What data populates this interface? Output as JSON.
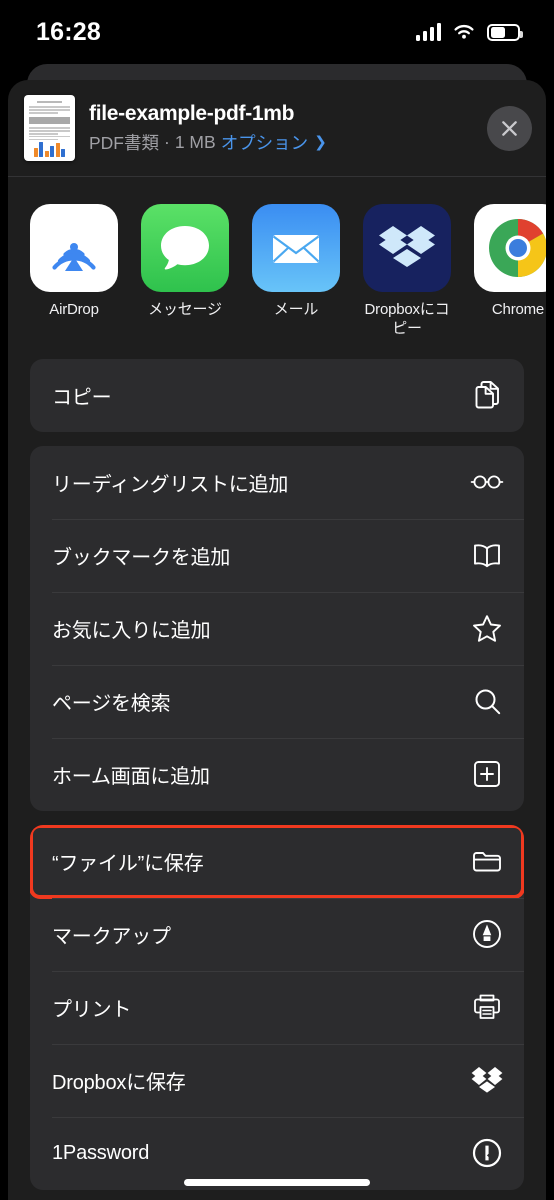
{
  "status_bar": {
    "time": "16:28",
    "cellular_icon": "cellular-bars-icon",
    "wifi_icon": "wifi-icon",
    "battery_icon": "battery-icon",
    "battery_level": 52
  },
  "share_sheet": {
    "file": {
      "name": "file-example-pdf-1mb",
      "kind": "PDF書類",
      "separator": "·",
      "size": "1 MB",
      "options_label": "オプション",
      "options_chevron": "chevron-right-icon",
      "thumbnail_icon": "pdf-thumbnail"
    },
    "close_label": "×",
    "apps": [
      {
        "label": "AirDrop",
        "icon": "airdrop-icon"
      },
      {
        "label": "メッセージ",
        "icon": "messages-icon"
      },
      {
        "label": "メール",
        "icon": "mail-icon"
      },
      {
        "label": "Dropboxにコピー",
        "icon": "dropbox-icon"
      },
      {
        "label": "Chrome",
        "icon": "chrome-icon"
      }
    ],
    "groups": [
      {
        "rows": [
          {
            "label": "コピー",
            "icon": "copy-icon",
            "highlighted": false
          }
        ]
      },
      {
        "rows": [
          {
            "label": "リーディングリストに追加",
            "icon": "glasses-icon",
            "highlighted": false
          },
          {
            "label": "ブックマークを追加",
            "icon": "book-icon",
            "highlighted": false
          },
          {
            "label": "お気に入りに追加",
            "icon": "star-icon",
            "highlighted": false
          },
          {
            "label": "ページを検索",
            "icon": "search-icon",
            "highlighted": false
          },
          {
            "label": "ホーム画面に追加",
            "icon": "plus-square-icon",
            "highlighted": false
          }
        ]
      },
      {
        "rows": [
          {
            "label": "“ファイル”に保存",
            "icon": "folder-icon",
            "highlighted": true
          },
          {
            "label": "マークアップ",
            "icon": "markup-pen-icon",
            "highlighted": false
          },
          {
            "label": "プリント",
            "icon": "printer-icon",
            "highlighted": false
          },
          {
            "label": "Dropboxに保存",
            "icon": "dropbox-icon",
            "highlighted": false
          },
          {
            "label": "1Password",
            "icon": "onepassword-icon",
            "highlighted": false
          }
        ]
      }
    ]
  },
  "colors": {
    "accent_link": "#4a95ec",
    "highlight_border": "#f0391f",
    "sheet_background": "#1e1e1e",
    "group_background": "#2c2c2e"
  },
  "home_indicator": "home-indicator"
}
